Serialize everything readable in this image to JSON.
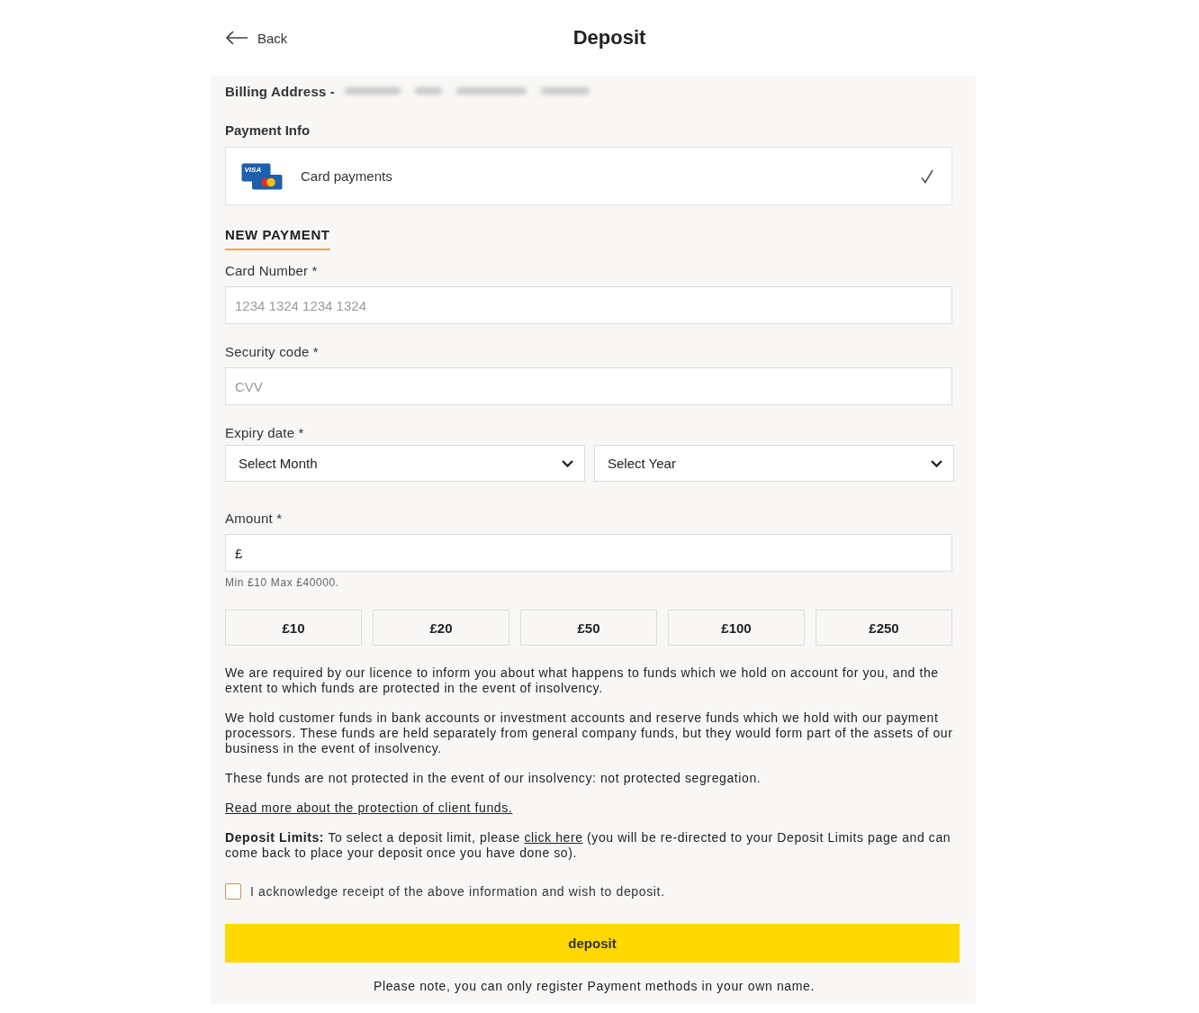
{
  "header": {
    "back_label": "Back",
    "title": "Deposit"
  },
  "billing_address": {
    "label": "Billing Address -",
    "redacted": true
  },
  "payment_info": {
    "heading": "Payment Info",
    "methods": [
      {
        "logo_text": "VISA",
        "label": "Card payments",
        "selected": true
      }
    ]
  },
  "new_payment": {
    "heading": "NEW PAYMENT",
    "fields": [
      {
        "kind": "input",
        "label": "Card Number *",
        "placeholder": "1234 1324 1234 1324"
      },
      {
        "kind": "input",
        "label": "Security code *",
        "placeholder": "CVV"
      },
      {
        "kind": "selects",
        "label": "Expiry date *",
        "selects": [
          {
            "value": "Select Month"
          },
          {
            "value": "Select Year"
          }
        ]
      },
      {
        "kind": "input",
        "label": "Amount *",
        "value": "£",
        "hint": "Min £10 Max £40000."
      }
    ],
    "quick_amounts": [
      "£10",
      "£20",
      "£50",
      "£100",
      "£250"
    ]
  },
  "info": [
    {
      "kind": "text",
      "text": "We are required by our licence to inform you about what happens to funds which we hold on account for you, and the extent to which funds are protected in the event of insolvency."
    },
    {
      "kind": "text",
      "text": "We hold customer funds in bank accounts or investment accounts and reserve funds which we hold with our payment processors. These funds are held separately from general company funds, but they would form part of the assets of our business in the event of insolvency."
    },
    {
      "kind": "text",
      "text": "These funds are not protected in the event of our insolvency: not protected segregation."
    },
    {
      "kind": "link",
      "text": "Read more about the protection of client funds."
    },
    {
      "kind": "mixed",
      "segments": [
        {
          "kind": "bold",
          "text": "Deposit Limits:"
        },
        {
          "kind": "plain",
          "text": "To select a deposit limit, please"
        },
        {
          "kind": "link",
          "text": "click here"
        },
        {
          "kind": "plain",
          "text": "(you will be re-directed to your Deposit Limits page and can come back to place your deposit once you have done so)."
        }
      ]
    }
  ],
  "acknowledge": {
    "label": "I acknowledge receipt of the above information and wish to deposit.",
    "checked": false
  },
  "submit": {
    "label": "deposit"
  },
  "note": "Please note, you can only register Payment methods in your own name."
}
